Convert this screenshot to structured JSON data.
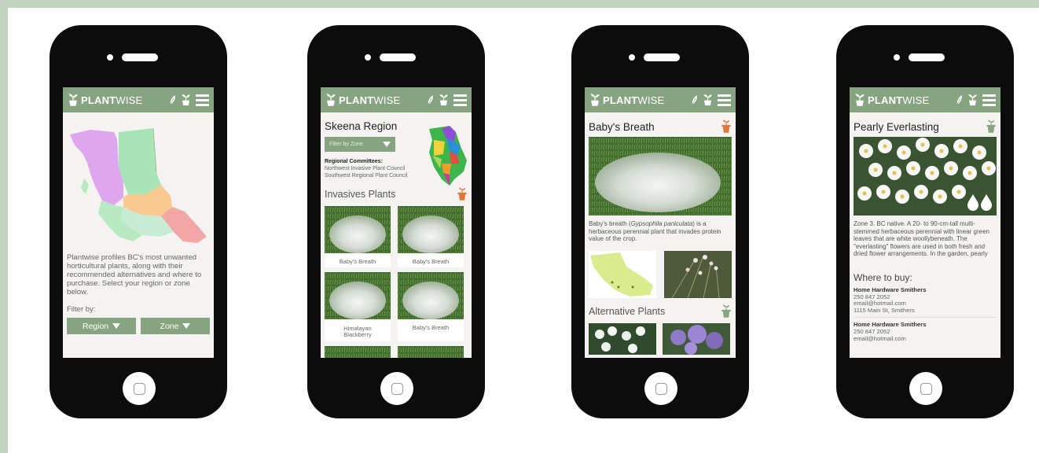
{
  "app": {
    "brand_bold": "PLANT",
    "brand_light": "WISE"
  },
  "colors": {
    "accent": "#86a47f",
    "orange": "#e07a3c",
    "background": "#c3d4c1"
  },
  "icons": {
    "logo": "potted-plant-icon",
    "bar": [
      "leaf-icon",
      "potted-plant-icon",
      "hamburger-menu-icon"
    ]
  },
  "screen1": {
    "intro": "Plantwise profiles BC's most unwanted horticultural plants, along with their recommended alternatives and where to purchase. Select your region or zone below.",
    "filter_label": "Filter by:",
    "region_button": "Region",
    "zone_button": "Zone"
  },
  "screen2": {
    "region_title": "Skeena Region",
    "zone_filter": "Filter by Zone",
    "committees_heading": "Regional Committees:",
    "committees": [
      "Northwest Invasive Plant Council",
      "Southwest Regional Plant Council"
    ],
    "section_title": "Invasives Plants",
    "plants": [
      "Baby's Breath",
      "Baby's Breath",
      "Himalayan Blackberry",
      "Baby's Breath"
    ]
  },
  "screen3": {
    "title": "Baby's Breath",
    "desc_before": "Baby's breath (",
    "desc_latin": "Gypsophila paniculata",
    "desc_after": ") is a herbaceous perennial plant that invades protein value of the crop.",
    "alt_title": "Alternative Plants"
  },
  "screen4": {
    "title": "Pearly Everlasting",
    "desc": "Zone 3. BC native. A 20- to 90-cm-tall multi-stemmed herbaceous perennial with linear green leaves that are white woollybeneath. The \"everlasting\" flowers are used in both fresh and dried flower arrangements. In the garden, pearly",
    "where_to_buy": "Where to buy:",
    "stores": [
      {
        "name": "Home Hardware Smithers",
        "phone": "250 847 2052",
        "email": "email@hotmail.com",
        "address": "1115 Main St, Smithers"
      },
      {
        "name": "Home Hardware Smithers",
        "phone": "250 847 2052",
        "email": "email@hotmail.com",
        "address": ""
      }
    ]
  }
}
